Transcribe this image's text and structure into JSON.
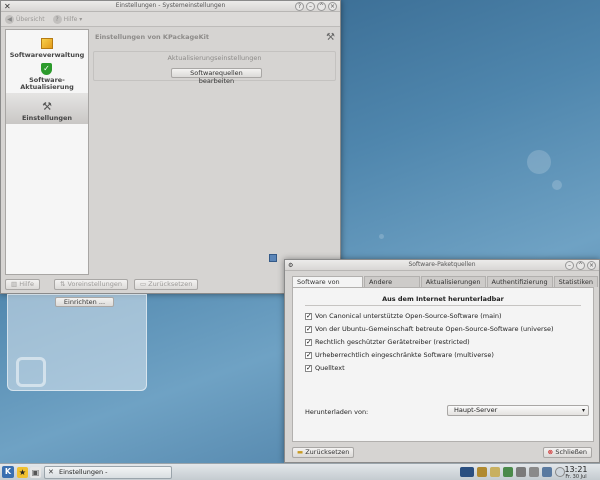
{
  "window1": {
    "title": "Einstellungen - Systemeinstellungen",
    "toolbar": {
      "overview": "Übersicht",
      "help": "Hilfe"
    },
    "sidebar": [
      {
        "label": "Softwareverwaltung",
        "icon": "package-icon"
      },
      {
        "label": "Software-\nAktualisierung",
        "icon": "shield-check-icon"
      },
      {
        "label": "Einstellungen",
        "icon": "wrench-icon"
      }
    ],
    "main": {
      "heading": "Einstellungen von KPackageKit",
      "group_title": "Aktualisierungseinstellungen",
      "edit_sources_button": "Softwarequellen bearbeiten"
    },
    "bottom": {
      "help": "Hilfe",
      "defaults": "Voreinstellungen",
      "reset": "Zurücksetzen"
    }
  },
  "widget": {
    "setup_button": "Einrichten ..."
  },
  "window2": {
    "title": "Software-Paketquellen",
    "tabs": [
      "Software von Kubuntu",
      "Andere Software",
      "Aktualisierungen",
      "Authentifizierung",
      "Statistiken"
    ],
    "section_title": "Aus dem Internet herunterladbar",
    "checkboxes": [
      {
        "label": "Von Canonical unterstützte Open-Source-Software (main)",
        "checked": true
      },
      {
        "label": "Von der Ubuntu-Gemeinschaft betreute Open-Source-Software (universe)",
        "checked": true
      },
      {
        "label": "Rechtlich geschützter Gerätetreiber (restricted)",
        "checked": true
      },
      {
        "label": "Urheberrechtlich eingeschränkte Software (multiverse)",
        "checked": true
      },
      {
        "label": "Quelltext",
        "checked": true
      }
    ],
    "download_from_label": "Herunterladen von:",
    "download_from_value": "Haupt-Server",
    "reset_button": "Zurücksetzen",
    "close_button": "Schließen"
  },
  "taskbar": {
    "task_label": "Einstellungen - Systemeinstellungen",
    "time": "13:21",
    "date": "Fr. 30 Jul"
  }
}
